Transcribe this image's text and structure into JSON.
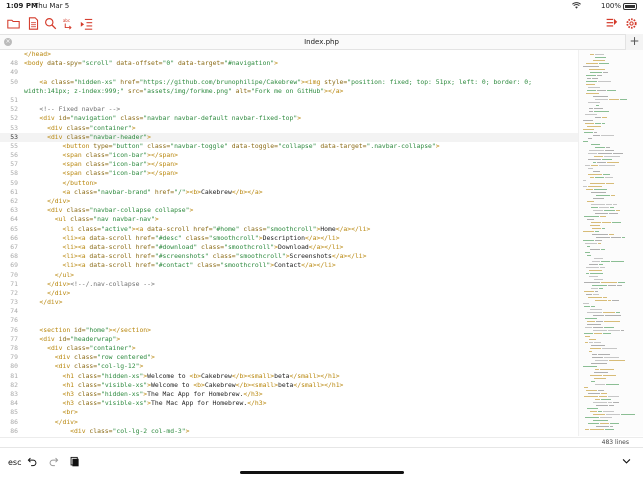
{
  "status_bar": {
    "time": "1:09 PM",
    "date": "Thu Mar 5",
    "battery": "100%"
  },
  "colors": {
    "accent": "#d43a2a",
    "tag": "#b8860b",
    "string": "#2d8a3e",
    "comment": "#6f6f6f"
  },
  "toolbar": {
    "left_icons": [
      "folder-icon",
      "file-icon",
      "search-icon",
      "replace-icon",
      "indent-icon"
    ],
    "right_icons": [
      "snippets-icon",
      "settings-icon"
    ]
  },
  "tab": {
    "title": "Index.php",
    "close": "×",
    "add": "+"
  },
  "editor": {
    "current_line": "53",
    "lines": [
      {
        "n": "",
        "parts": [
          [
            "tag",
            "</head>"
          ]
        ]
      },
      {
        "n": "48",
        "parts": [
          [
            "tag",
            "<body "
          ],
          [
            "attr",
            "data-spy="
          ],
          [
            "str",
            "\"scroll\""
          ],
          [
            "attr",
            " data-offset="
          ],
          [
            "str",
            "\"0\""
          ],
          [
            "attr",
            " data-target="
          ],
          [
            "str",
            "\"#navigation\""
          ],
          [
            "tag",
            ">"
          ]
        ]
      },
      {
        "n": "49",
        "parts": []
      },
      {
        "n": "50",
        "parts": [
          [
            "txt",
            "    "
          ],
          [
            "tag",
            "<a "
          ],
          [
            "attr",
            "class="
          ],
          [
            "str",
            "\"hidden-xs\""
          ],
          [
            "attr",
            " href="
          ],
          [
            "str",
            "\"https://github.com/brunophilipe/Cakebrew\""
          ],
          [
            "tag",
            "><img "
          ],
          [
            "attr",
            "style="
          ],
          [
            "str",
            "\"position: fixed; top: 51px; left: 0; border: 0;"
          ]
        ]
      },
      {
        "n": "",
        "parts": [
          [
            "str",
            "width:141px; z-index:999;\""
          ],
          [
            "attr",
            " src="
          ],
          [
            "str",
            "\"assets/img/forkme.png\""
          ],
          [
            "attr",
            " alt="
          ],
          [
            "str",
            "\"Fork me on GitHub\""
          ],
          [
            "tag",
            "></a>"
          ]
        ]
      },
      {
        "n": "51",
        "parts": []
      },
      {
        "n": "52",
        "parts": [
          [
            "txt",
            "    "
          ],
          [
            "cm",
            "<!-- Fixed navbar -->"
          ]
        ]
      },
      {
        "n": "52",
        "parts": [
          [
            "txt",
            "    "
          ],
          [
            "tag",
            "<div "
          ],
          [
            "attr",
            "id="
          ],
          [
            "str",
            "\"navigation\""
          ],
          [
            "attr",
            " class="
          ],
          [
            "str",
            "\"navbar navbar-default navbar-fixed-top\""
          ],
          [
            "tag",
            ">"
          ]
        ]
      },
      {
        "n": "53",
        "parts": [
          [
            "txt",
            "      "
          ],
          [
            "tag",
            "<div "
          ],
          [
            "attr",
            "class="
          ],
          [
            "str",
            "\"container\""
          ],
          [
            "tag",
            ">"
          ]
        ]
      },
      {
        "n": "53",
        "parts": [
          [
            "txt",
            "      "
          ],
          [
            "tag",
            "<div "
          ],
          [
            "attr",
            "class="
          ],
          [
            "str",
            "\"navbar-header\""
          ],
          [
            "tag",
            ">"
          ]
        ]
      },
      {
        "n": "55",
        "parts": [
          [
            "txt",
            "          "
          ],
          [
            "tag",
            "<button "
          ],
          [
            "attr",
            "type="
          ],
          [
            "str",
            "\"button\""
          ],
          [
            "attr",
            " class="
          ],
          [
            "str",
            "\"navbar-toggle\""
          ],
          [
            "attr",
            " data-toggle="
          ],
          [
            "str",
            "\"collapse\""
          ],
          [
            "attr",
            " data-target="
          ],
          [
            "str",
            "\".navbar-collapse\""
          ],
          [
            "tag",
            ">"
          ]
        ]
      },
      {
        "n": "56",
        "parts": [
          [
            "txt",
            "          "
          ],
          [
            "tag",
            "<span "
          ],
          [
            "attr",
            "class="
          ],
          [
            "str",
            "\"icon-bar\""
          ],
          [
            "tag",
            "></span>"
          ]
        ]
      },
      {
        "n": "57",
        "parts": [
          [
            "txt",
            "          "
          ],
          [
            "tag",
            "<span "
          ],
          [
            "attr",
            "class="
          ],
          [
            "str",
            "\"icon-bar\""
          ],
          [
            "tag",
            "></span>"
          ]
        ]
      },
      {
        "n": "58",
        "parts": [
          [
            "txt",
            "          "
          ],
          [
            "tag",
            "<span "
          ],
          [
            "attr",
            "class="
          ],
          [
            "str",
            "\"icon-bar\""
          ],
          [
            "tag",
            "></span>"
          ]
        ]
      },
      {
        "n": "59",
        "parts": [
          [
            "txt",
            "          "
          ],
          [
            "tag",
            "</button>"
          ]
        ]
      },
      {
        "n": "61",
        "parts": [
          [
            "txt",
            "          "
          ],
          [
            "tag",
            "<a "
          ],
          [
            "attr",
            "class="
          ],
          [
            "str",
            "\"navbar-brand\""
          ],
          [
            "attr",
            " href="
          ],
          [
            "str",
            "\"/\""
          ],
          [
            "tag",
            "><b>"
          ],
          [
            "txt",
            "Cakebrew"
          ],
          [
            "tag",
            "</b></a>"
          ]
        ]
      },
      {
        "n": "62",
        "parts": [
          [
            "txt",
            "      "
          ],
          [
            "tag",
            "</div>"
          ]
        ]
      },
      {
        "n": "63",
        "parts": [
          [
            "txt",
            "      "
          ],
          [
            "tag",
            "<div "
          ],
          [
            "attr",
            "class="
          ],
          [
            "str",
            "\"navbar-collapse collapse\""
          ],
          [
            "tag",
            ">"
          ]
        ]
      },
      {
        "n": "64",
        "parts": [
          [
            "txt",
            "        "
          ],
          [
            "tag",
            "<ul "
          ],
          [
            "attr",
            "class="
          ],
          [
            "str",
            "\"nav navbar-nav\""
          ],
          [
            "tag",
            ">"
          ]
        ]
      },
      {
        "n": "65",
        "parts": [
          [
            "txt",
            "          "
          ],
          [
            "tag",
            "<li "
          ],
          [
            "attr",
            "class="
          ],
          [
            "str",
            "\"active\""
          ],
          [
            "tag",
            "><a "
          ],
          [
            "attr",
            "data-scroll href="
          ],
          [
            "str",
            "\"#home\""
          ],
          [
            "attr",
            " class="
          ],
          [
            "str",
            "\"smoothcroll\""
          ],
          [
            "tag",
            ">"
          ],
          [
            "txt",
            "Home"
          ],
          [
            "tag",
            "</a></li>"
          ]
        ]
      },
      {
        "n": "66",
        "parts": [
          [
            "txt",
            "          "
          ],
          [
            "tag",
            "<li><a "
          ],
          [
            "attr",
            "data-scroll href="
          ],
          [
            "str",
            "\"#desc\""
          ],
          [
            "attr",
            " class="
          ],
          [
            "str",
            "\"smoothcroll\""
          ],
          [
            "tag",
            ">"
          ],
          [
            "txt",
            "Description"
          ],
          [
            "tag",
            "</a></li>"
          ]
        ]
      },
      {
        "n": "67",
        "parts": [
          [
            "txt",
            "          "
          ],
          [
            "tag",
            "<li><a "
          ],
          [
            "attr",
            "data-scroll href="
          ],
          [
            "str",
            "\"#download\""
          ],
          [
            "attr",
            " class="
          ],
          [
            "str",
            "\"smoothcroll\""
          ],
          [
            "tag",
            ">"
          ],
          [
            "txt",
            "Download"
          ],
          [
            "tag",
            "</a></li>"
          ]
        ]
      },
      {
        "n": "68",
        "parts": [
          [
            "txt",
            "          "
          ],
          [
            "tag",
            "<li><a "
          ],
          [
            "attr",
            "data-scroll href="
          ],
          [
            "str",
            "\"#screenshots\""
          ],
          [
            "attr",
            " class="
          ],
          [
            "str",
            "\"smoothcroll\""
          ],
          [
            "tag",
            ">"
          ],
          [
            "txt",
            "Screenshots"
          ],
          [
            "tag",
            "</a></li>"
          ]
        ]
      },
      {
        "n": "69",
        "parts": [
          [
            "txt",
            "          "
          ],
          [
            "tag",
            "<li><a "
          ],
          [
            "attr",
            "data-scroll href="
          ],
          [
            "str",
            "\"#contact\""
          ],
          [
            "attr",
            " class="
          ],
          [
            "str",
            "\"smoothcroll\""
          ],
          [
            "tag",
            ">"
          ],
          [
            "txt",
            "Contact"
          ],
          [
            "tag",
            "</a></li>"
          ]
        ]
      },
      {
        "n": "70",
        "parts": [
          [
            "txt",
            "        "
          ],
          [
            "tag",
            "</ul>"
          ]
        ]
      },
      {
        "n": "71",
        "parts": [
          [
            "txt",
            "      "
          ],
          [
            "tag",
            "</div>"
          ],
          [
            "cm",
            "<!--/.nav-collapse -->"
          ]
        ]
      },
      {
        "n": "72",
        "parts": [
          [
            "txt",
            "      "
          ],
          [
            "tag",
            "</div>"
          ]
        ]
      },
      {
        "n": "73",
        "parts": [
          [
            "txt",
            "    "
          ],
          [
            "tag",
            "</div>"
          ]
        ]
      },
      {
        "n": "74",
        "parts": []
      },
      {
        "n": "76",
        "parts": []
      },
      {
        "n": "76",
        "parts": [
          [
            "txt",
            "    "
          ],
          [
            "tag",
            "<section "
          ],
          [
            "attr",
            "id="
          ],
          [
            "str",
            "\"home\""
          ],
          [
            "tag",
            "></section>"
          ]
        ]
      },
      {
        "n": "77",
        "parts": [
          [
            "txt",
            "    "
          ],
          [
            "tag",
            "<div "
          ],
          [
            "attr",
            "id="
          ],
          [
            "str",
            "\"headerwrap\""
          ],
          [
            "tag",
            ">"
          ]
        ]
      },
      {
        "n": "78",
        "parts": [
          [
            "txt",
            "      "
          ],
          [
            "tag",
            "<div "
          ],
          [
            "attr",
            "class="
          ],
          [
            "str",
            "\"container\""
          ],
          [
            "tag",
            ">"
          ]
        ]
      },
      {
        "n": "79",
        "parts": [
          [
            "txt",
            "        "
          ],
          [
            "tag",
            "<div "
          ],
          [
            "attr",
            "class="
          ],
          [
            "str",
            "\"row centered\""
          ],
          [
            "tag",
            ">"
          ]
        ]
      },
      {
        "n": "80",
        "parts": [
          [
            "txt",
            "        "
          ],
          [
            "tag",
            "<div "
          ],
          [
            "attr",
            "class="
          ],
          [
            "str",
            "\"col-lg-12\""
          ],
          [
            "tag",
            ">"
          ]
        ]
      },
      {
        "n": "81",
        "parts": [
          [
            "txt",
            "          "
          ],
          [
            "tag",
            "<h1 "
          ],
          [
            "attr",
            "class="
          ],
          [
            "str",
            "\"hidden-xs\""
          ],
          [
            "tag",
            ">"
          ],
          [
            "txt",
            "Welcome to "
          ],
          [
            "tag",
            "<b>"
          ],
          [
            "txt",
            "Cakebrew"
          ],
          [
            "tag",
            "</b><small>"
          ],
          [
            "txt",
            "beta"
          ],
          [
            "tag",
            "</small></h1>"
          ]
        ]
      },
      {
        "n": "82",
        "parts": [
          [
            "txt",
            "          "
          ],
          [
            "tag",
            "<h1 "
          ],
          [
            "attr",
            "class="
          ],
          [
            "str",
            "\"visible-xs\""
          ],
          [
            "tag",
            ">"
          ],
          [
            "txt",
            "Welcome to "
          ],
          [
            "tag",
            "<b>"
          ],
          [
            "txt",
            "Cakebrew"
          ],
          [
            "tag",
            "</b><small>"
          ],
          [
            "txt",
            "beta"
          ],
          [
            "tag",
            "</small></h1>"
          ]
        ]
      },
      {
        "n": "83",
        "parts": [
          [
            "txt",
            "          "
          ],
          [
            "tag",
            "<h3 "
          ],
          [
            "attr",
            "class="
          ],
          [
            "str",
            "\"hidden-xs\""
          ],
          [
            "tag",
            ">"
          ],
          [
            "txt",
            "The Mac App for Homebrew."
          ],
          [
            "tag",
            "</h3>"
          ]
        ]
      },
      {
        "n": "84",
        "parts": [
          [
            "txt",
            "          "
          ],
          [
            "tag",
            "<h3 "
          ],
          [
            "attr",
            "class="
          ],
          [
            "str",
            "\"visible-xs\""
          ],
          [
            "tag",
            ">"
          ],
          [
            "txt",
            "The Mac App for Homebrew."
          ],
          [
            "tag",
            "</h3>"
          ]
        ]
      },
      {
        "n": "85",
        "parts": [
          [
            "txt",
            "          "
          ],
          [
            "tag",
            "<br>"
          ]
        ]
      },
      {
        "n": "86",
        "parts": [
          [
            "txt",
            "        "
          ],
          [
            "tag",
            "</div>"
          ]
        ]
      },
      {
        "n": "86",
        "parts": [
          [
            "txt",
            "            "
          ],
          [
            "tag",
            "<div "
          ],
          [
            "attr",
            "class="
          ],
          [
            "str",
            "\"col-lg-2 col-md-3\""
          ],
          [
            "tag",
            ">"
          ]
        ]
      }
    ]
  },
  "footer": {
    "line_count": "483 lines"
  },
  "keyboard_bar": {
    "esc": "esc"
  }
}
